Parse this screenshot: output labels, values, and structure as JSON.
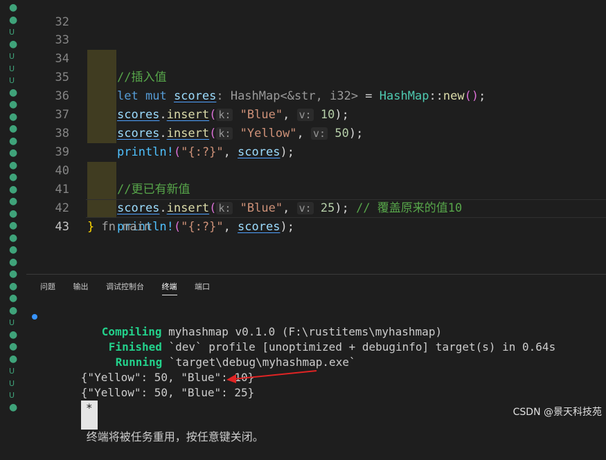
{
  "editor": {
    "lines": [
      {
        "num": "32"
      },
      {
        "num": "33",
        "comment": "//插入值"
      },
      {
        "num": "34",
        "let": "let",
        "mut": "mut",
        "var": "scores",
        "type_hint": ": HashMap<&str, i32>",
        "eq": " = ",
        "type": "HashMap",
        "sep": "::",
        "fn": "new",
        "open": "(",
        "close": ")",
        "semi": ";"
      },
      {
        "num": "35",
        "var": "scores",
        "dot": ".",
        "fn": "insert",
        "hint_k": "k:",
        "str": "\"Blue\"",
        "comma": ", ",
        "hint_v": "v:",
        "num_val": "10",
        "semi": ");"
      },
      {
        "num": "36",
        "var": "scores",
        "dot": ".",
        "fn": "insert",
        "hint_k": "k:",
        "str": "\"Yellow\"",
        "comma": ", ",
        "hint_v": "v:",
        "num_val": "50",
        "semi": ");"
      },
      {
        "num": "37",
        "macro": "println!",
        "open": "(",
        "fmt": "\"{:?}\"",
        "comma": ", ",
        "var": "scores",
        "close": ");"
      },
      {
        "num": "38"
      },
      {
        "num": "39",
        "comment": "//更已有新值"
      },
      {
        "num": "40",
        "var": "scores",
        "dot": ".",
        "fn": "insert",
        "hint_k": "k:",
        "str": "\"Blue\"",
        "comma": ", ",
        "hint_v": "v:",
        "num_val": "25",
        "semi": ");",
        "trailing_comment": " // 覆盖原来的值10"
      },
      {
        "num": "41",
        "macro": "println!",
        "open": "(",
        "fmt": "\"{:?}\"",
        "comma": ", ",
        "var": "scores",
        "close": ");"
      },
      {
        "num": "42",
        "brace": "}",
        "end_hint": " fn main"
      },
      {
        "num": "43"
      }
    ]
  },
  "panel": {
    "tabs": [
      "问题",
      "输出",
      "调试控制台",
      "终端",
      "端口"
    ],
    "active_tab": "终端"
  },
  "terminal": {
    "compiling_label": "Compiling",
    "compiling_text": " myhashmap v0.1.0 (F:\\rustitems\\myhashmap)",
    "finished_label": "Finished",
    "finished_text": " `dev` profile [unoptimized + debuginfo] target(s) in 0.64s",
    "running_label": "Running",
    "running_text": " `target\\debug\\myhashmap.exe`",
    "output1": "{\"Yellow\": 50, \"Blue\": 10}",
    "output2": "{\"Yellow\": 50, \"Blue\": 25}",
    "badge": "*",
    "notice": "终端将被任务重用，按任意键关闭。"
  },
  "gutter_marks": [
    "●",
    "●",
    "U",
    "●",
    "U",
    "U",
    "U",
    "●",
    "●",
    "●",
    "●",
    "●",
    "●",
    "●",
    "●",
    "●",
    "●",
    "●",
    "●",
    "●",
    "●",
    "●",
    "●",
    "●",
    "●",
    "●",
    "U",
    "●",
    "●",
    "●",
    "U",
    "U",
    "U",
    "●"
  ],
  "watermark": "CSDN @景天科技苑",
  "colors": {
    "accent": "#3794ff",
    "arrow": "#e02424"
  }
}
